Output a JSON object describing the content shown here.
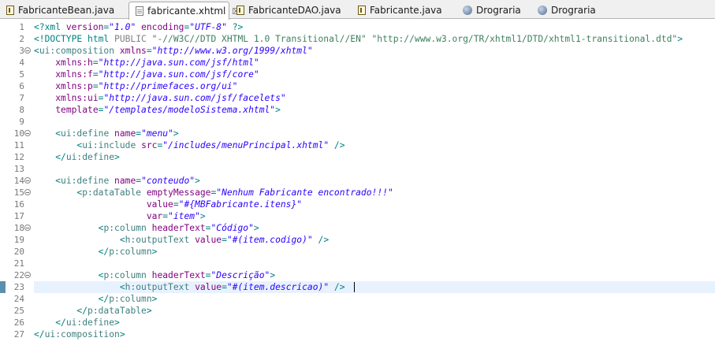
{
  "tabs": [
    {
      "label": "FabricanteBean.java",
      "icon": "java-file-icon",
      "active": false
    },
    {
      "label": "fabricante.xhtml",
      "icon": "xhtml-file-icon",
      "active": true,
      "close": "☒"
    },
    {
      "label": "FabricanteDAO.java",
      "icon": "java-file-icon",
      "active": false
    },
    {
      "label": "Fabricante.java",
      "icon": "java-file-icon",
      "active": false
    },
    {
      "label": "Drograria",
      "icon": "globe-icon",
      "active": false
    },
    {
      "label": "Drograria",
      "icon": "globe-icon",
      "active": false
    }
  ],
  "editor": {
    "current_line": 23,
    "lines": [
      {
        "n": "1",
        "segs": [
          [
            "pi",
            "<?xml "
          ],
          [
            "attr",
            "version"
          ],
          [
            "punct",
            "="
          ],
          [
            "val",
            "\"1.0\""
          ],
          [
            "punct",
            " "
          ],
          [
            "attr",
            "encoding"
          ],
          [
            "punct",
            "="
          ],
          [
            "val",
            "\"UTF-8\""
          ],
          [
            "pi",
            " ?>"
          ]
        ]
      },
      {
        "n": "2",
        "segs": [
          [
            "doctype",
            "<!DOCTYPE "
          ],
          [
            "doctype",
            "html "
          ],
          [
            "dockw",
            "PUBLIC "
          ],
          [
            "docstr",
            "\"-//W3C//DTD XHTML 1.0 Transitional//EN\" "
          ],
          [
            "docstr",
            "\"http://www.w3.org/TR/xhtml1/DTD/xhtml1-transitional.dtd\""
          ],
          [
            "doctype",
            ">"
          ]
        ]
      },
      {
        "n": "3",
        "fold": true,
        "segs": [
          [
            "punct",
            "<"
          ],
          [
            "tag",
            "ui:composition "
          ],
          [
            "attr",
            "xmlns"
          ],
          [
            "punct",
            "="
          ],
          [
            "val",
            "\"http://www.w3.org/1999/xhtml\""
          ]
        ]
      },
      {
        "n": "4",
        "segs": [
          [
            "text",
            "    "
          ],
          [
            "attr",
            "xmlns:h"
          ],
          [
            "punct",
            "="
          ],
          [
            "val",
            "\"http://java.sun.com/jsf/html\""
          ]
        ]
      },
      {
        "n": "5",
        "segs": [
          [
            "text",
            "    "
          ],
          [
            "attr",
            "xmlns:f"
          ],
          [
            "punct",
            "="
          ],
          [
            "val",
            "\"http://java.sun.com/jsf/core\""
          ]
        ]
      },
      {
        "n": "6",
        "segs": [
          [
            "text",
            "    "
          ],
          [
            "attr",
            "xmlns:p"
          ],
          [
            "punct",
            "="
          ],
          [
            "val",
            "\"http://primefaces.org/ui\""
          ]
        ]
      },
      {
        "n": "7",
        "segs": [
          [
            "text",
            "    "
          ],
          [
            "attr",
            "xmlns:ui"
          ],
          [
            "punct",
            "="
          ],
          [
            "val",
            "\"http://java.sun.com/jsf/facelets\""
          ]
        ]
      },
      {
        "n": "8",
        "segs": [
          [
            "text",
            "    "
          ],
          [
            "attr",
            "template"
          ],
          [
            "punct",
            "="
          ],
          [
            "val",
            "\"/templates/modeloSistema.xhtml\""
          ],
          [
            "punct",
            ">"
          ]
        ]
      },
      {
        "n": "9",
        "segs": []
      },
      {
        "n": "10",
        "fold": true,
        "segs": [
          [
            "text",
            "    "
          ],
          [
            "punct",
            "<"
          ],
          [
            "tag",
            "ui:define "
          ],
          [
            "attr",
            "name"
          ],
          [
            "punct",
            "="
          ],
          [
            "val",
            "\"menu\""
          ],
          [
            "punct",
            ">"
          ]
        ]
      },
      {
        "n": "11",
        "segs": [
          [
            "text",
            "        "
          ],
          [
            "punct",
            "<"
          ],
          [
            "tag",
            "ui:include "
          ],
          [
            "attr",
            "src"
          ],
          [
            "punct",
            "="
          ],
          [
            "val",
            "\"/includes/menuPrincipal.xhtml\""
          ],
          [
            "punct",
            " />"
          ]
        ]
      },
      {
        "n": "12",
        "segs": [
          [
            "text",
            "    "
          ],
          [
            "punct",
            "</"
          ],
          [
            "tag",
            "ui:define"
          ],
          [
            "punct",
            ">"
          ]
        ]
      },
      {
        "n": "13",
        "segs": []
      },
      {
        "n": "14",
        "fold": true,
        "segs": [
          [
            "text",
            "    "
          ],
          [
            "punct",
            "<"
          ],
          [
            "tag",
            "ui:define "
          ],
          [
            "attr",
            "name"
          ],
          [
            "punct",
            "="
          ],
          [
            "val",
            "\"conteudo\""
          ],
          [
            "punct",
            ">"
          ]
        ]
      },
      {
        "n": "15",
        "fold": true,
        "segs": [
          [
            "text",
            "        "
          ],
          [
            "punct",
            "<"
          ],
          [
            "tag",
            "p:dataTable "
          ],
          [
            "attr",
            "emptyMessage"
          ],
          [
            "punct",
            "="
          ],
          [
            "val",
            "\"Nenhum Fabricante encontrado!!!\""
          ]
        ]
      },
      {
        "n": "16",
        "segs": [
          [
            "text",
            "                     "
          ],
          [
            "attr",
            "value"
          ],
          [
            "punct",
            "="
          ],
          [
            "val",
            "\"#{MBFabricante.itens}\""
          ]
        ]
      },
      {
        "n": "17",
        "segs": [
          [
            "text",
            "                     "
          ],
          [
            "attr",
            "var"
          ],
          [
            "punct",
            "="
          ],
          [
            "val",
            "\"item\""
          ],
          [
            "punct",
            ">"
          ]
        ]
      },
      {
        "n": "18",
        "fold": true,
        "segs": [
          [
            "text",
            "            "
          ],
          [
            "punct",
            "<"
          ],
          [
            "tag",
            "p:column "
          ],
          [
            "attr",
            "headerText"
          ],
          [
            "punct",
            "="
          ],
          [
            "val",
            "\"Código\""
          ],
          [
            "punct",
            ">"
          ]
        ]
      },
      {
        "n": "19",
        "segs": [
          [
            "text",
            "                "
          ],
          [
            "punct",
            "<"
          ],
          [
            "tag",
            "h:outputText "
          ],
          [
            "attr",
            "value"
          ],
          [
            "punct",
            "="
          ],
          [
            "val",
            "\"#(item.codigo)\""
          ],
          [
            "punct",
            " />"
          ]
        ]
      },
      {
        "n": "20",
        "segs": [
          [
            "text",
            "            "
          ],
          [
            "punct",
            "</"
          ],
          [
            "tag",
            "p:column"
          ],
          [
            "punct",
            ">"
          ]
        ]
      },
      {
        "n": "21",
        "segs": []
      },
      {
        "n": "22",
        "fold": true,
        "segs": [
          [
            "text",
            "            "
          ],
          [
            "punct",
            "<"
          ],
          [
            "tag",
            "p:column "
          ],
          [
            "attr",
            "headerText"
          ],
          [
            "punct",
            "="
          ],
          [
            "val",
            "\"Descrição\""
          ],
          [
            "punct",
            ">"
          ]
        ]
      },
      {
        "n": "23",
        "ruler": true,
        "segs": [
          [
            "text",
            "                "
          ],
          [
            "punct",
            "<"
          ],
          [
            "tag",
            "h:outputText "
          ],
          [
            "attr",
            "value"
          ],
          [
            "punct",
            "="
          ],
          [
            "val",
            "\"#(item.descricao)\""
          ],
          [
            "punct",
            " />"
          ]
        ]
      },
      {
        "n": "24",
        "segs": [
          [
            "text",
            "            "
          ],
          [
            "punct",
            "</"
          ],
          [
            "tag",
            "p:column"
          ],
          [
            "punct",
            ">"
          ]
        ]
      },
      {
        "n": "25",
        "segs": [
          [
            "text",
            "        "
          ],
          [
            "punct",
            "</"
          ],
          [
            "tag",
            "p:dataTable"
          ],
          [
            "punct",
            ">"
          ]
        ]
      },
      {
        "n": "26",
        "segs": [
          [
            "text",
            "    "
          ],
          [
            "punct",
            "</"
          ],
          [
            "tag",
            "ui:define"
          ],
          [
            "punct",
            ">"
          ]
        ]
      },
      {
        "n": "27",
        "segs": [
          [
            "punct",
            "</"
          ],
          [
            "tag",
            "ui:composition"
          ],
          [
            "punct",
            ">"
          ]
        ]
      }
    ]
  }
}
